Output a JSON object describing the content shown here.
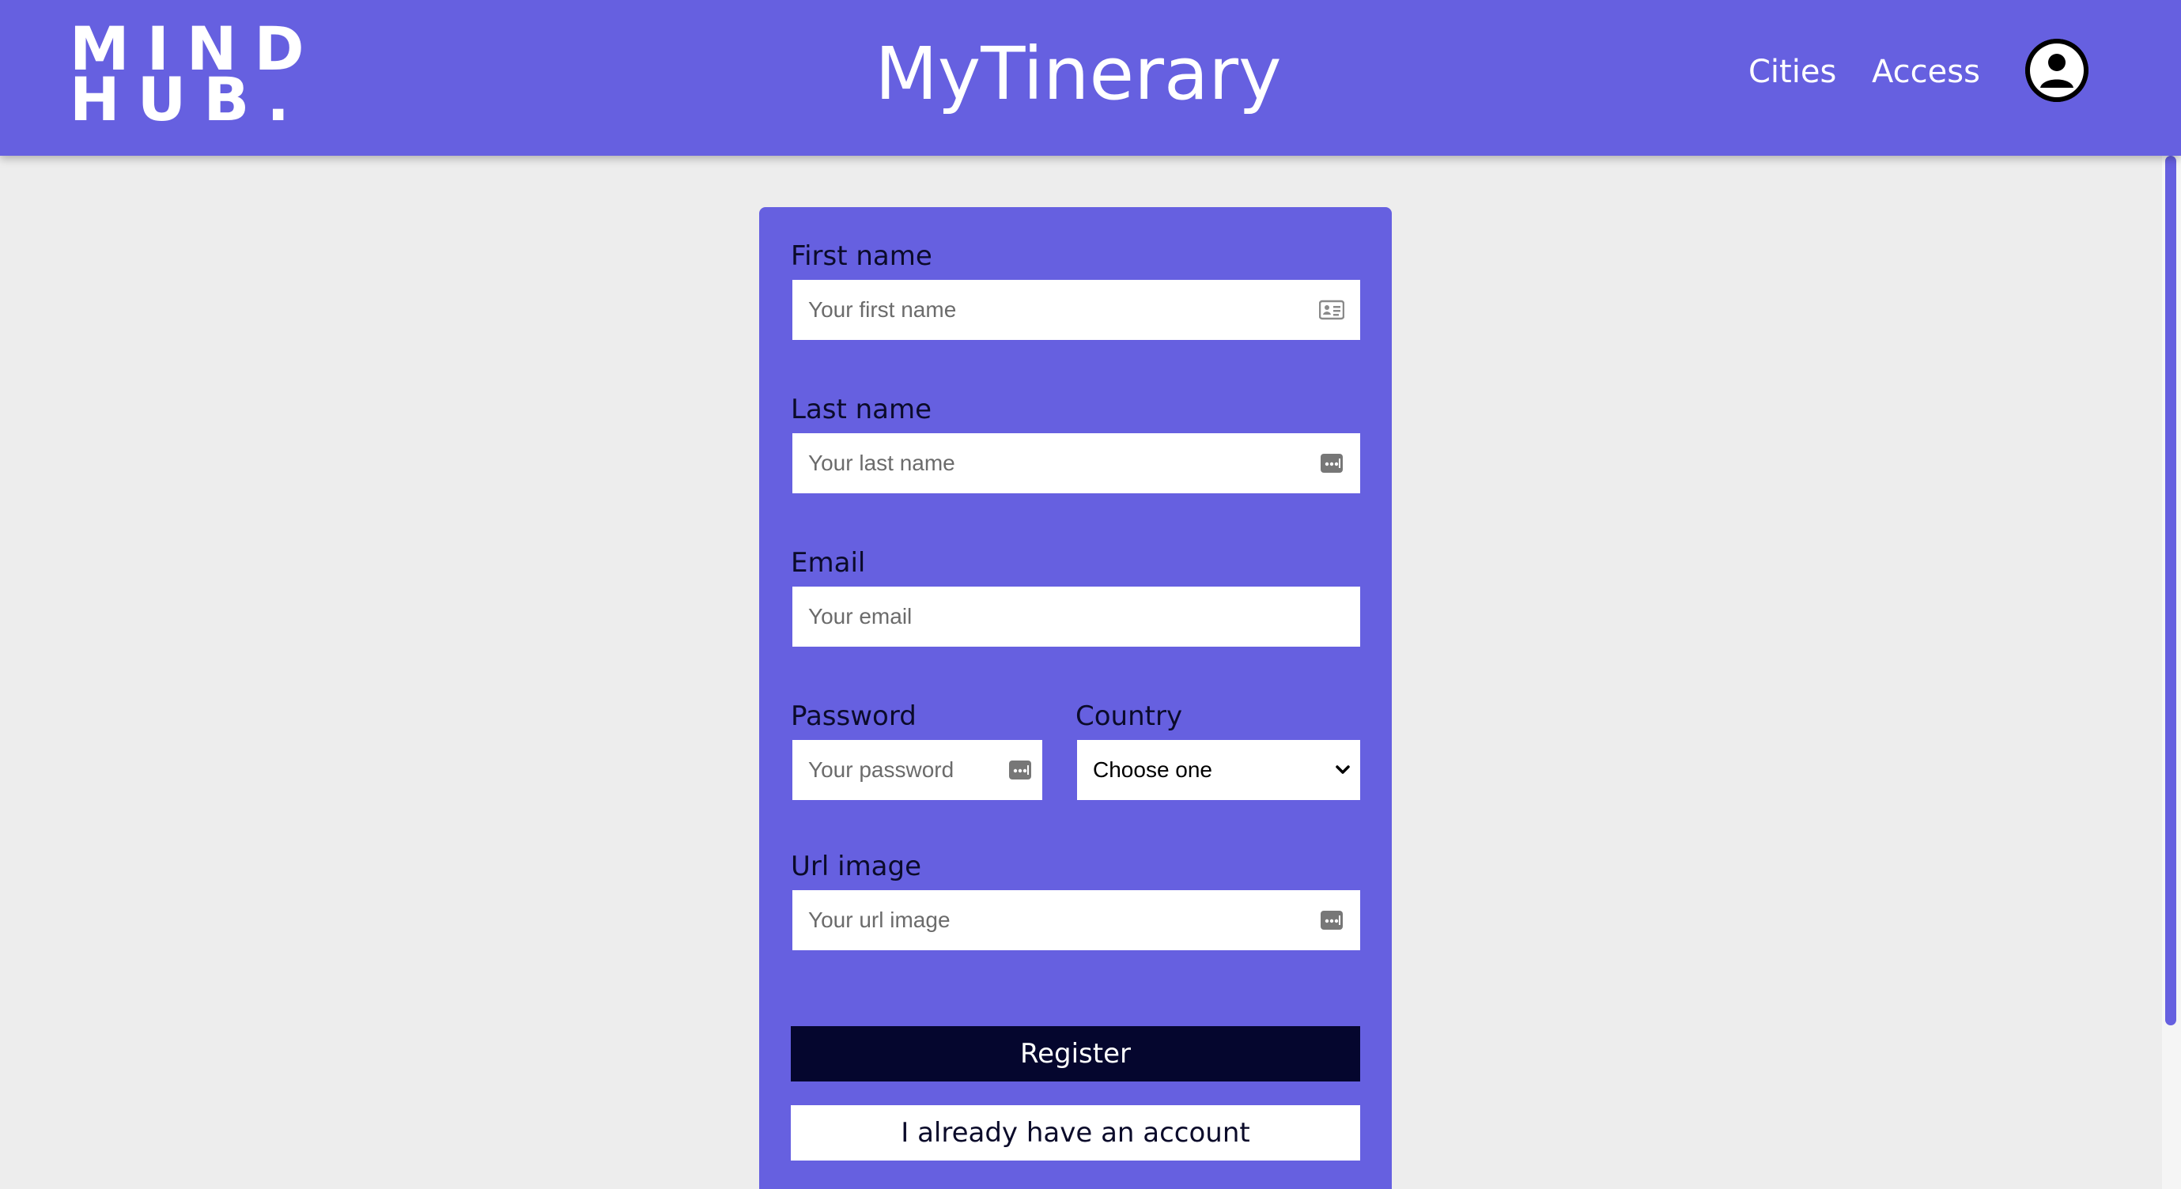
{
  "header": {
    "logo_line1": "MIND",
    "logo_line2": "HUB",
    "logo_dot": ".",
    "app_title": "MyTinerary",
    "nav": {
      "cities": "Cities",
      "access": "Access"
    },
    "avatar_icon": "user-circle-icon",
    "background_color": "#6660e0"
  },
  "form": {
    "first_name": {
      "label": "First name",
      "placeholder": "Your first name",
      "icon": "id-card-icon"
    },
    "last_name": {
      "label": "Last name",
      "placeholder": "Your last name",
      "icon": "autofill-dots-icon"
    },
    "email": {
      "label": "Email",
      "placeholder": "Your email"
    },
    "password": {
      "label": "Password",
      "placeholder": "Your password",
      "icon": "autofill-dots-icon"
    },
    "country": {
      "label": "Country",
      "selected": "Choose one",
      "icon": "chevron-down-icon"
    },
    "url_image": {
      "label": "Url image",
      "placeholder": "Your url image",
      "icon": "autofill-dots-icon"
    },
    "register_label": "Register",
    "login_label": "I already have an account",
    "card_color": "#6660e0",
    "register_color": "#05062e"
  }
}
